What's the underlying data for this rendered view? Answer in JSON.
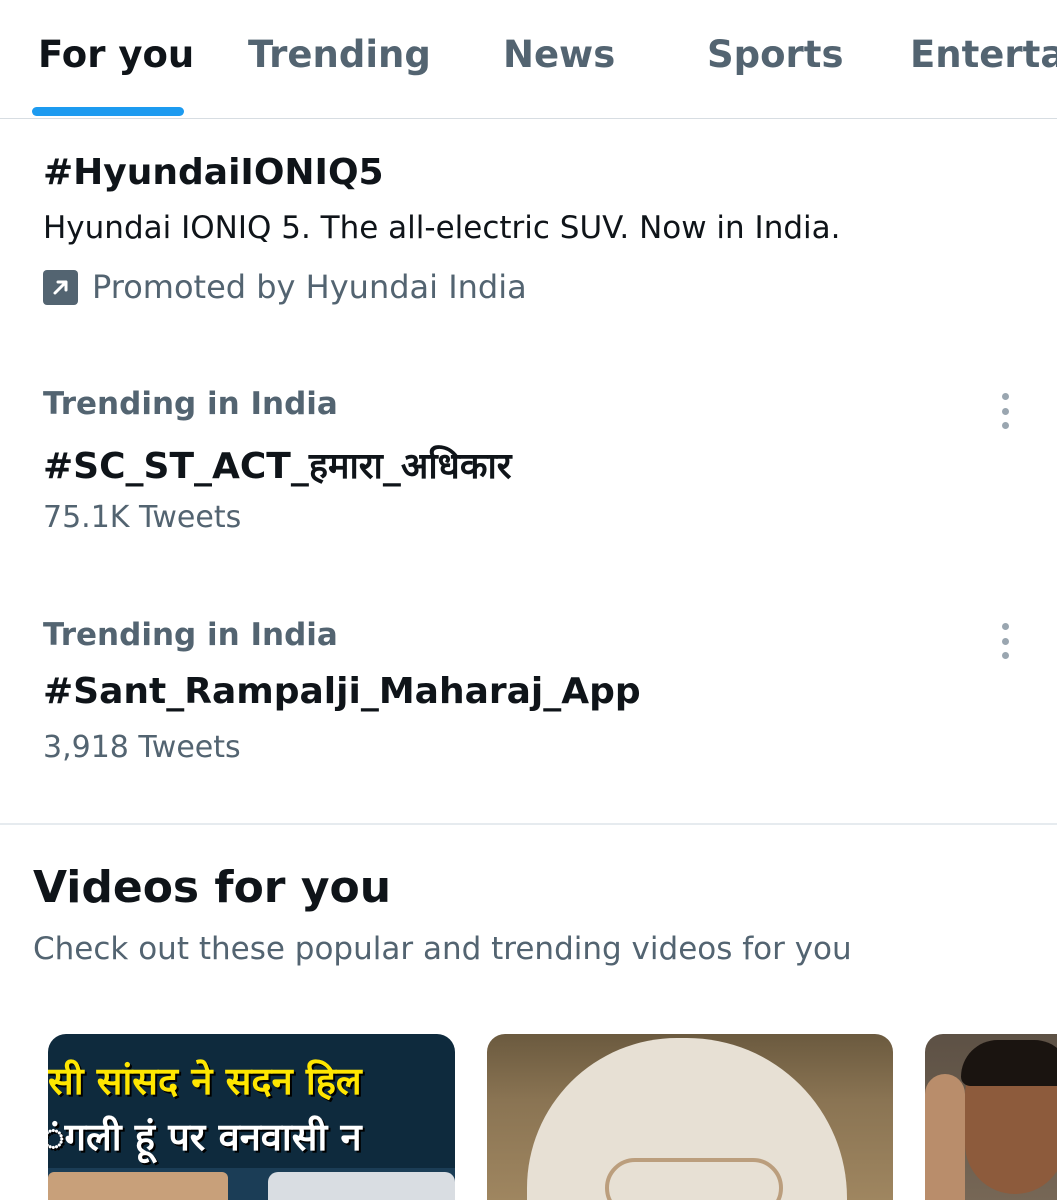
{
  "tabs": [
    {
      "label": "For you",
      "active": true
    },
    {
      "label": "Trending",
      "active": false
    },
    {
      "label": "News",
      "active": false
    },
    {
      "label": "Sports",
      "active": false
    },
    {
      "label": "Entertai",
      "active": false
    }
  ],
  "promoted": {
    "hashtag": "#HyundaiIONIQ5",
    "description": "Hyundai IONIQ 5. The all-electric SUV. Now in India.",
    "promoted_by": "Promoted by Hyundai India"
  },
  "trends": [
    {
      "context": "Trending in India",
      "hashtag": "#SC_ST_ACT_हमारा_अधिकार",
      "count": "75.1K Tweets"
    },
    {
      "context": "Trending in India",
      "hashtag": "#Sant_Rampalji_Maharaj_App",
      "count": "3,918 Tweets"
    }
  ],
  "videos_section": {
    "title": "Videos for you",
    "subtitle": "Check out these popular and trending videos for you",
    "videos": [
      {
        "caption_line1": "सी सांसद ने सदन हिल",
        "caption_line2": "ंगली हूं पर वनवासी न"
      }
    ]
  },
  "colors": {
    "accent": "#1d9bf0",
    "primary_text": "#0f1419",
    "secondary_text": "#536471",
    "divider": "#e6ebef"
  }
}
